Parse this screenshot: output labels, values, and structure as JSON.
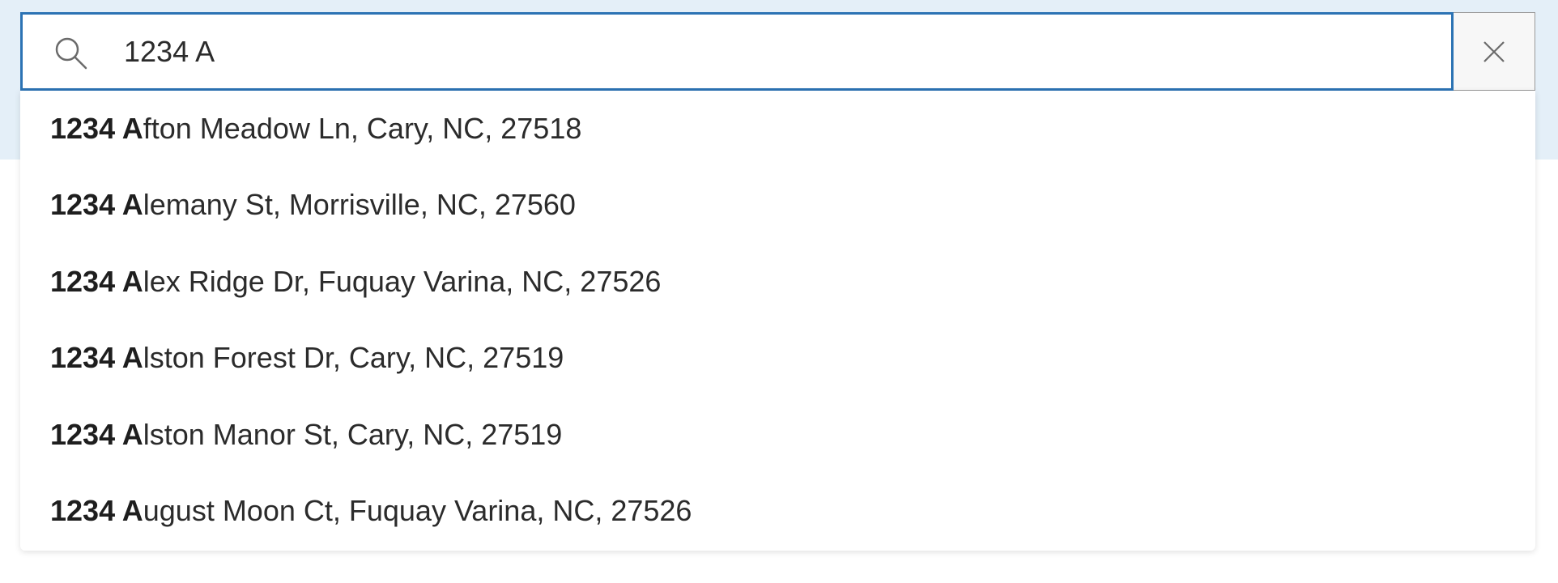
{
  "search": {
    "value": "1234 A",
    "icon": "search-icon",
    "clear_icon": "close-icon"
  },
  "suggestions": [
    {
      "match": "1234 A",
      "rest": "fton Meadow Ln, Cary, NC, 27518"
    },
    {
      "match": "1234 A",
      "rest": "lemany St, Morrisville, NC, 27560"
    },
    {
      "match": "1234 A",
      "rest": "lex Ridge Dr, Fuquay Varina, NC, 27526"
    },
    {
      "match": "1234 A",
      "rest": "lston Forest Dr, Cary, NC, 27519"
    },
    {
      "match": "1234 A",
      "rest": "lston Manor St, Cary, NC, 27519"
    },
    {
      "match": "1234 A",
      "rest": "ugust Moon Ct, Fuquay Varina, NC, 27526"
    }
  ],
  "colors": {
    "header_band": "#e4eff8",
    "focus_border": "#2c73b4",
    "text": "#2b2b2b"
  }
}
